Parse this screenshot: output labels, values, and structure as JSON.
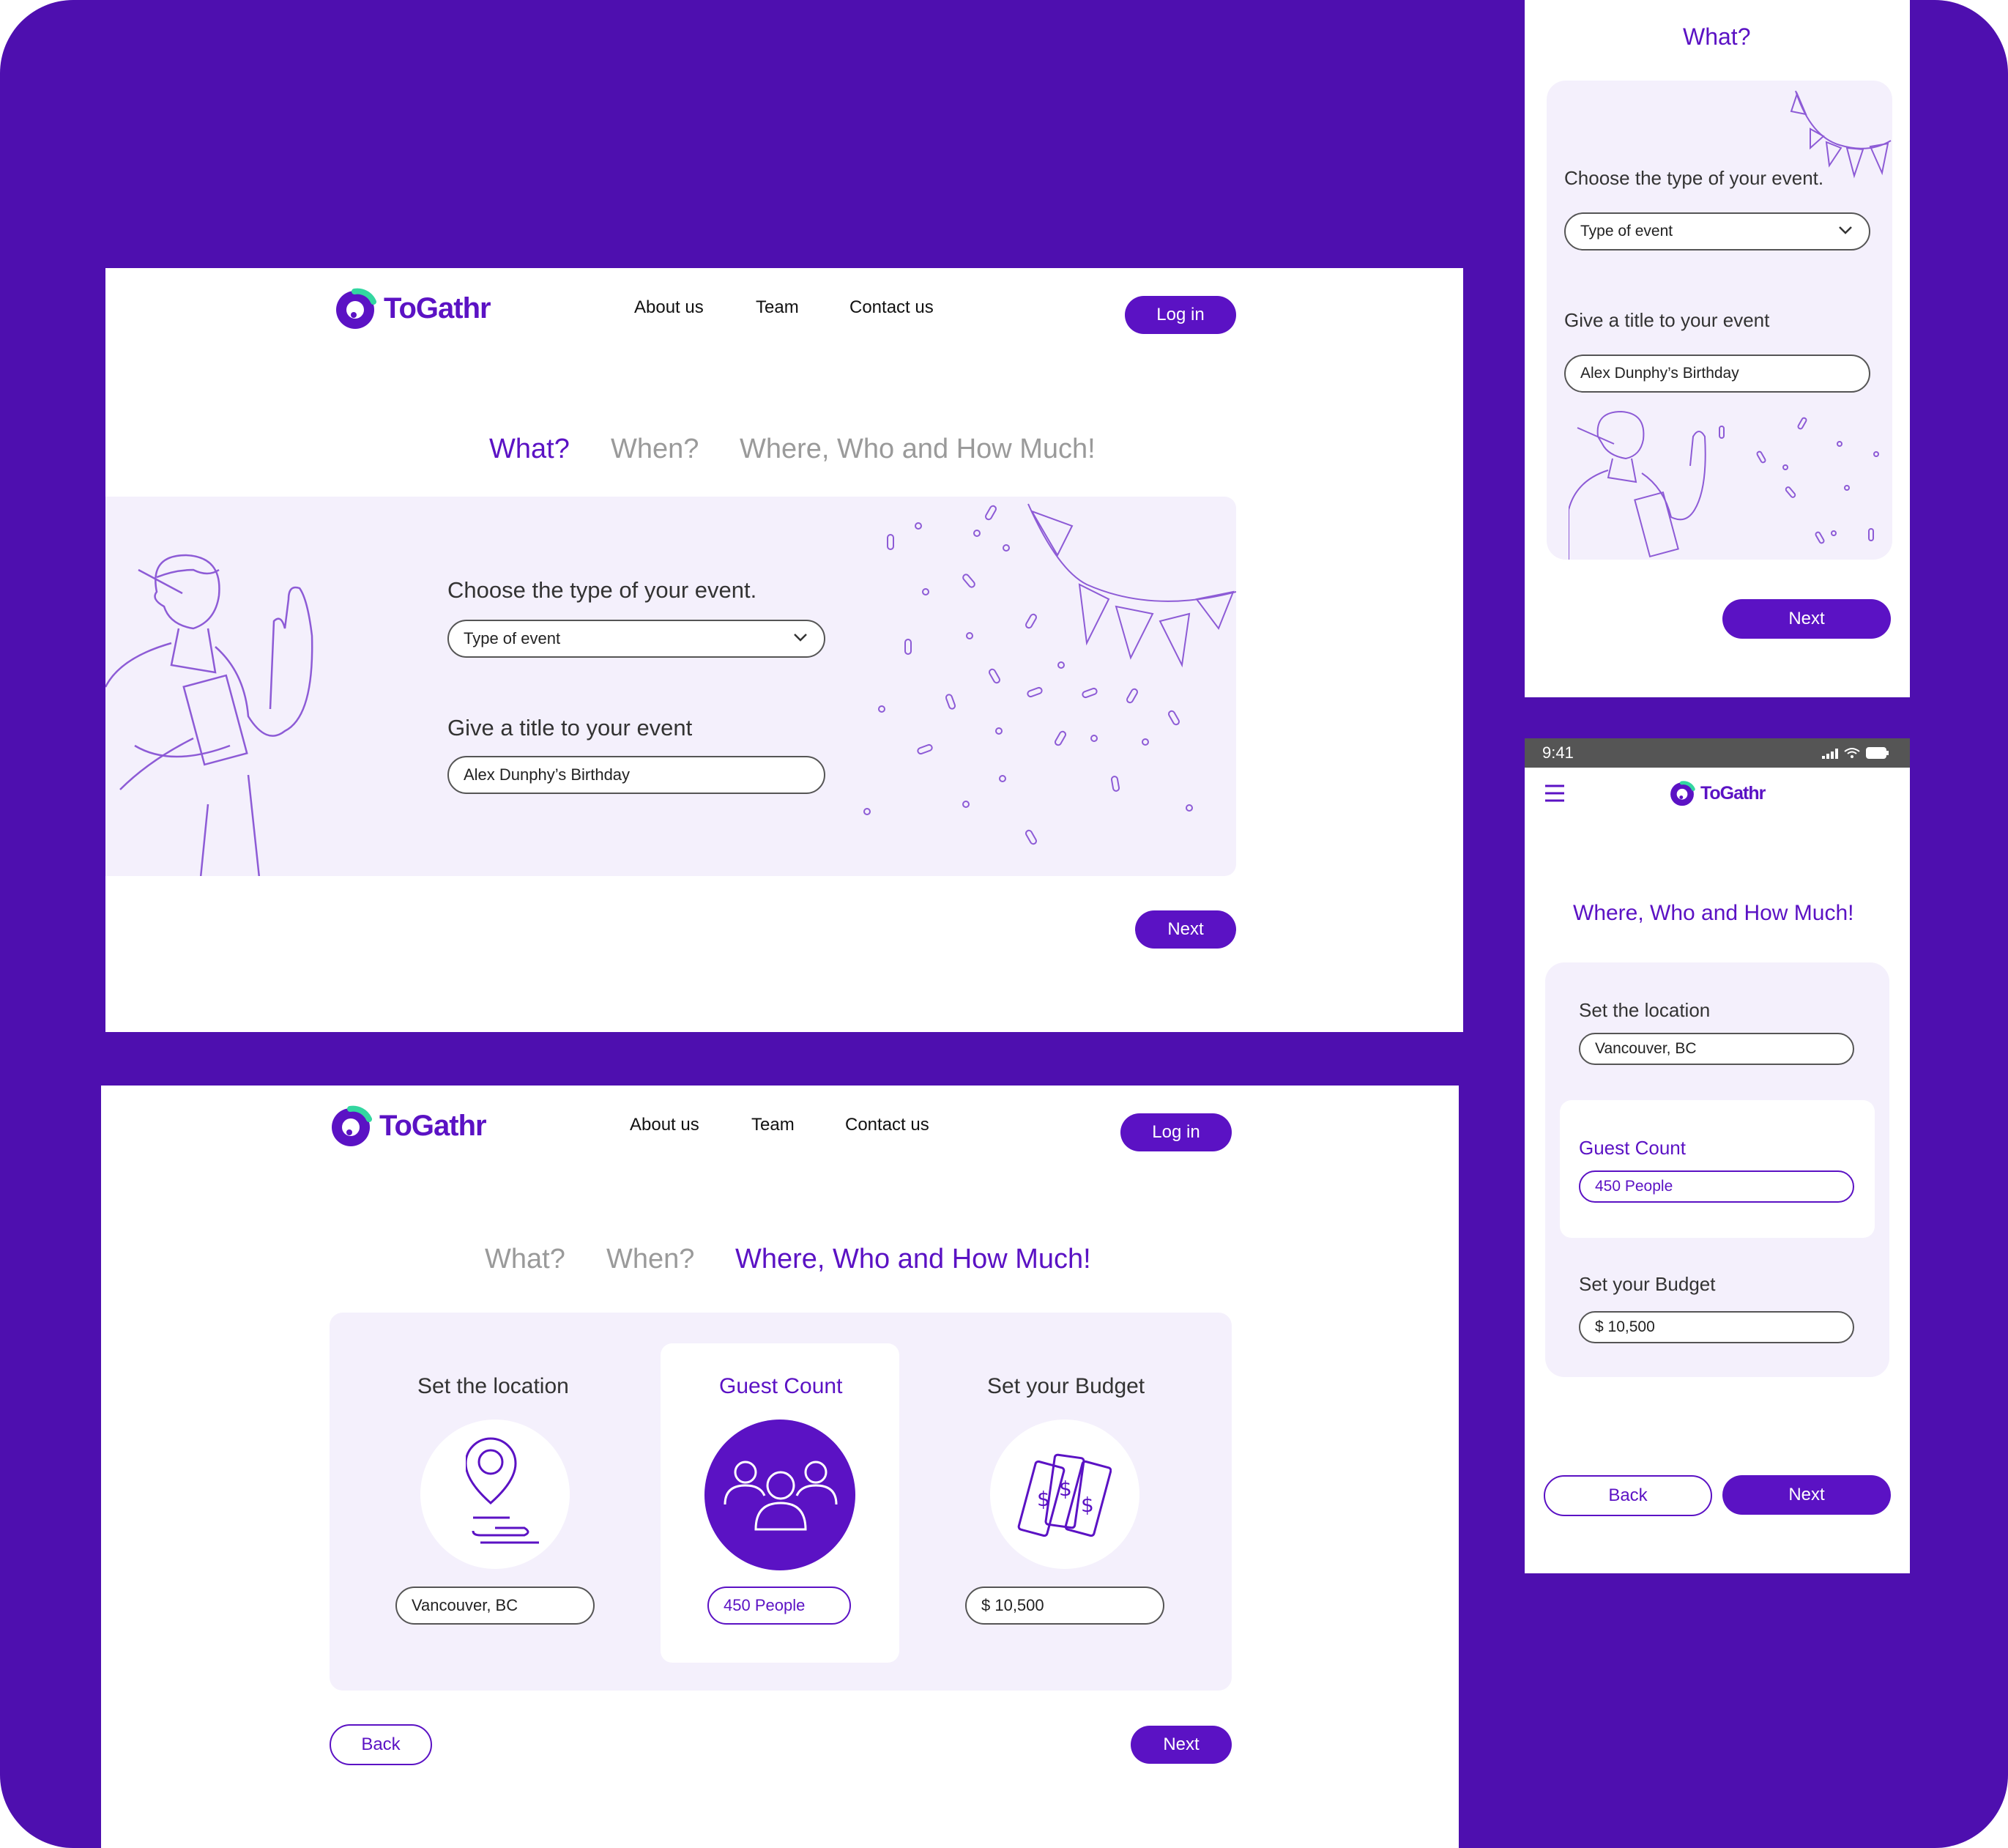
{
  "brand": {
    "name": "ToGathr",
    "color": "#5B12C4",
    "bg": "#4E0FAF",
    "panel": "#F4F0FC"
  },
  "nav": {
    "about": "About us",
    "team": "Team",
    "contact": "Contact us",
    "login": "Log in"
  },
  "steps": {
    "what": "What?",
    "when": "When?",
    "where": "Where, Who and How Much!"
  },
  "what_form": {
    "type_label": "Choose the type of your event.",
    "type_placeholder": "Type of event",
    "title_label": "Give a title to your event",
    "title_value": "Alex Dunphy’s Birthday"
  },
  "where_form": {
    "location_label": "Set the location",
    "location_value": "Vancouver, BC",
    "guest_label": "Guest Count",
    "guest_value": "450 People",
    "budget_label": "Set your Budget",
    "budget_value": "$ 10,500"
  },
  "buttons": {
    "next": "Next",
    "back": "Back"
  },
  "status_bar": {
    "time": "9:41"
  },
  "icons": [
    "logo-icon",
    "chevron-down-icon",
    "location-pin-icon",
    "people-icon",
    "money-icon",
    "hamburger-icon",
    "signal-icon",
    "wifi-icon",
    "battery-icon"
  ]
}
